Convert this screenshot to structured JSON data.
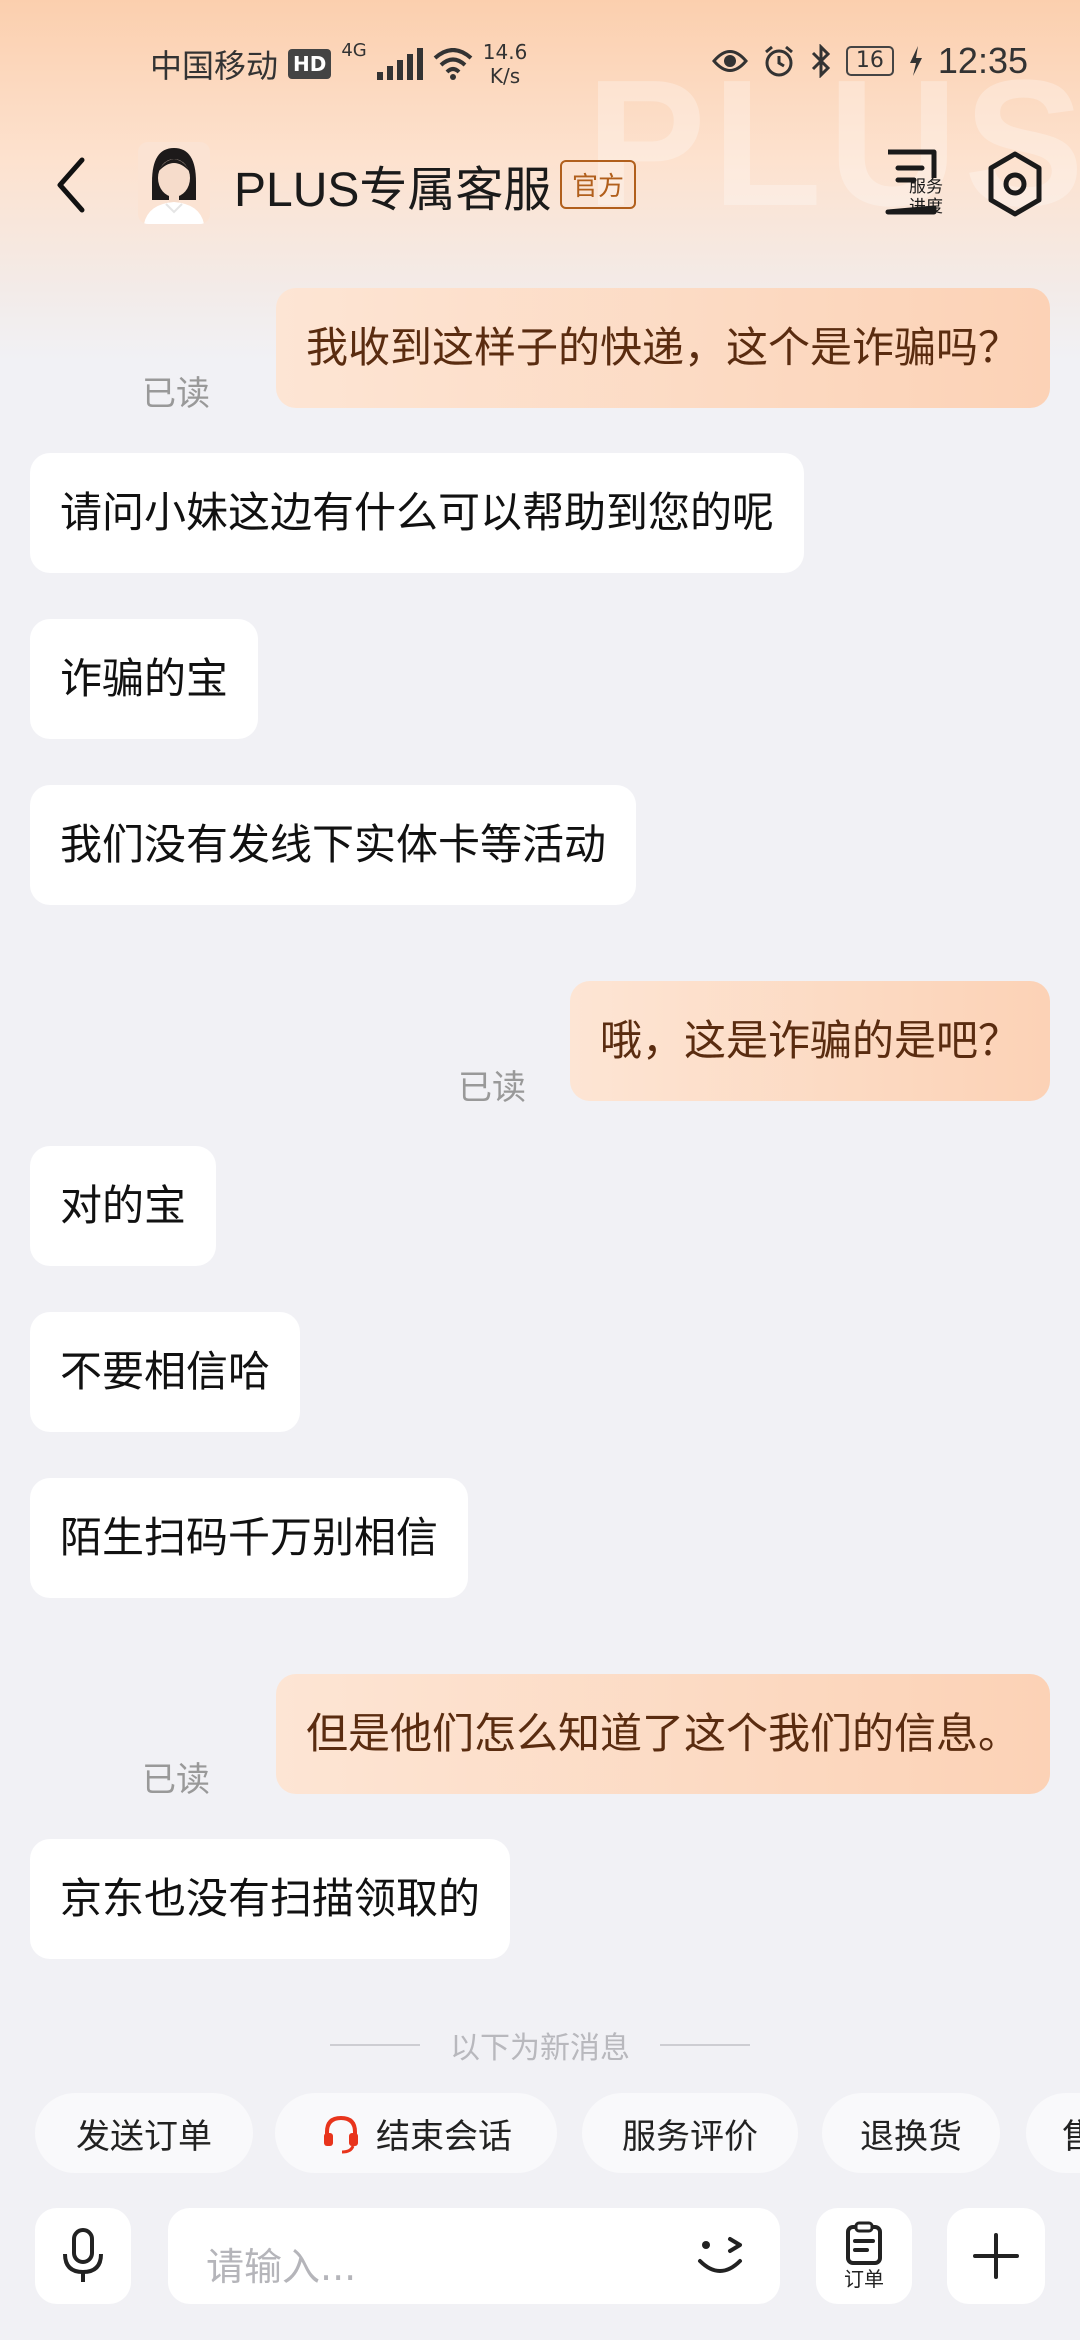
{
  "status_bar": {
    "carrier": "中国移动",
    "hd": "HD",
    "network": "4G",
    "speed_value": "14.6",
    "speed_unit": "K/s",
    "battery": "16",
    "time": "12:35"
  },
  "header": {
    "title": "PLUS专属客服",
    "badge": "官方",
    "watermark": "PLUS",
    "service_progress_label_line1": "服务",
    "service_progress_label_line2": "进度"
  },
  "messages": [
    {
      "dir": "out",
      "text": "我收到这样子的快递，这个是诈骗吗？",
      "read": "已读"
    },
    {
      "dir": "in",
      "text": "请问小妹这边有什么可以帮助到您的呢"
    },
    {
      "dir": "in",
      "text": "诈骗的宝"
    },
    {
      "dir": "in",
      "text": "我们没有发线下实体卡等活动"
    },
    {
      "dir": "out",
      "text": "哦，这是诈骗的是吧？",
      "read": "已读"
    },
    {
      "dir": "in",
      "text": "对的宝"
    },
    {
      "dir": "in",
      "text": "不要相信哈"
    },
    {
      "dir": "in",
      "text": "陌生扫码千万别相信"
    },
    {
      "dir": "out",
      "text": "但是他们怎么知道了这个我们的信息。",
      "read": "已读"
    },
    {
      "dir": "in",
      "text": "京东也没有扫描领取的"
    }
  ],
  "divider": "以下为新消息",
  "quick_actions": [
    {
      "label": "发送订单"
    },
    {
      "label": "结束会话",
      "icon": "headset-icon"
    },
    {
      "label": "服务评价"
    },
    {
      "label": "退换货"
    },
    {
      "label": "售"
    }
  ],
  "input": {
    "placeholder": "请输入...",
    "order_label": "订单"
  },
  "colors": {
    "accent": "#e8341c",
    "out_bubble": "#fcd9c1",
    "out_text": "#5a2c10",
    "badge": "#b15f1c",
    "background": "#f1f1f5"
  }
}
